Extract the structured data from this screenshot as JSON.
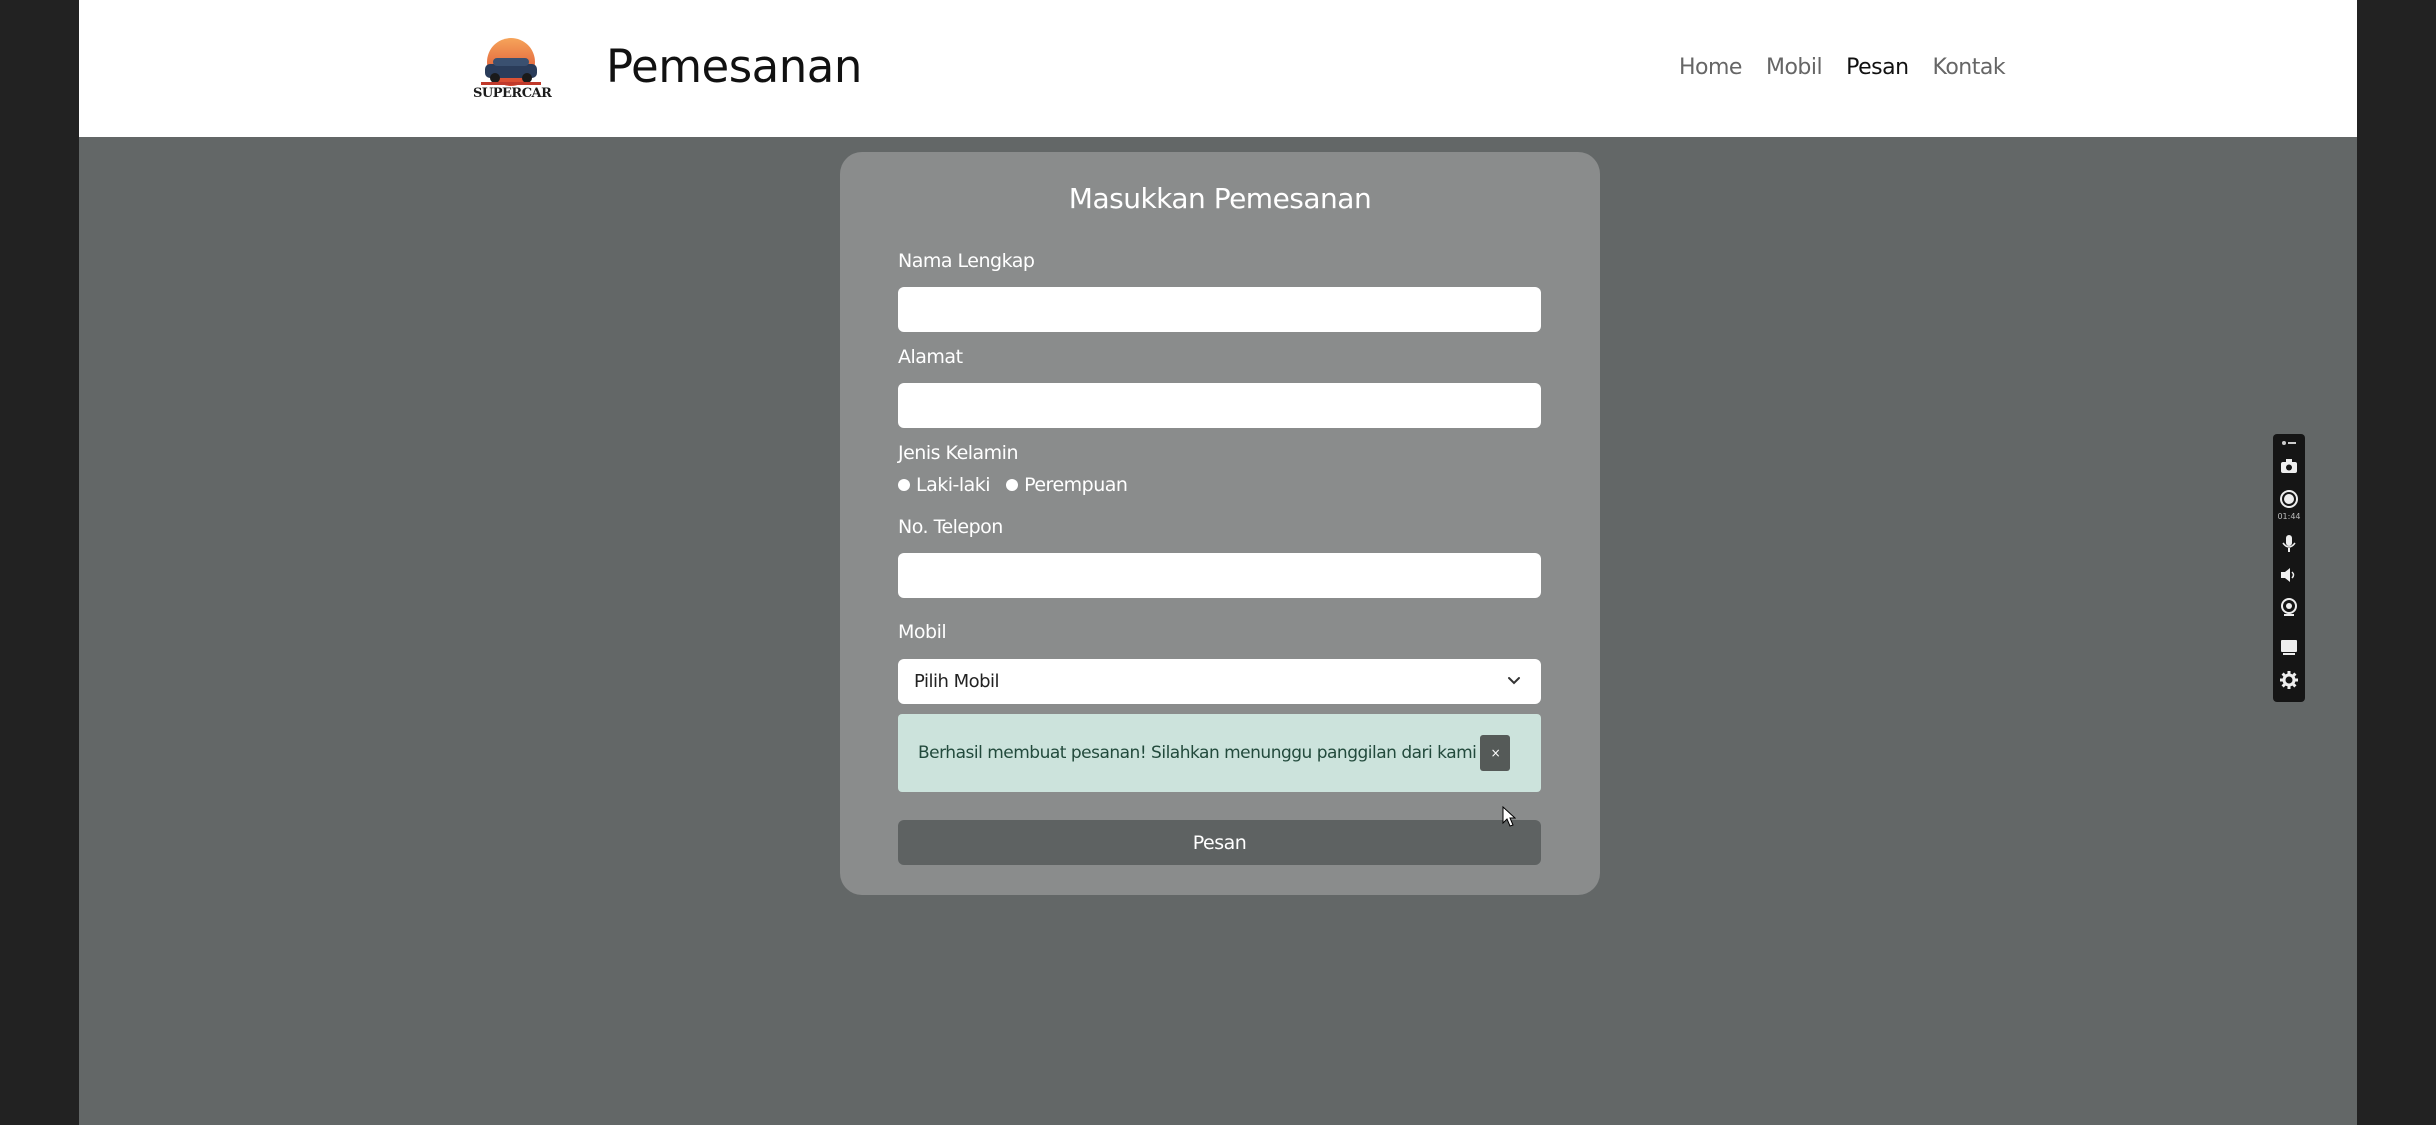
{
  "header": {
    "logo_text": "SUPERCAR",
    "title": "Pemesanan",
    "nav": [
      {
        "label": "Home"
      },
      {
        "label": "Mobil"
      },
      {
        "label": "Pesan",
        "active": true
      },
      {
        "label": "Kontak"
      }
    ]
  },
  "form": {
    "heading": "Masukkan Pemesanan",
    "name_label": "Nama Lengkap",
    "name_value": "",
    "address_label": "Alamat",
    "address_value": "",
    "gender_label": "Jenis Kelamin",
    "gender_options": [
      "Laki-laki",
      "Perempuan"
    ],
    "phone_label": "No. Telepon",
    "phone_value": "",
    "car_label": "Mobil",
    "car_selected": "Pilih Mobil",
    "success_message": "Berhasil membuat pesanan! Silahkan menunggu panggilan dari kami",
    "close_glyph": "×",
    "submit_label": "Pesan"
  },
  "recorder": {
    "timer": "01:44",
    "icons": [
      "camera-icon",
      "record-icon",
      "microphone-icon",
      "speaker-icon",
      "webcam-icon",
      "screen-icon",
      "gear-icon"
    ]
  },
  "colors": {
    "page_bg": "#636767",
    "card_bg": "#8a8c8c",
    "alert_bg": "#cce3dc",
    "button_bg": "#5e6262"
  }
}
